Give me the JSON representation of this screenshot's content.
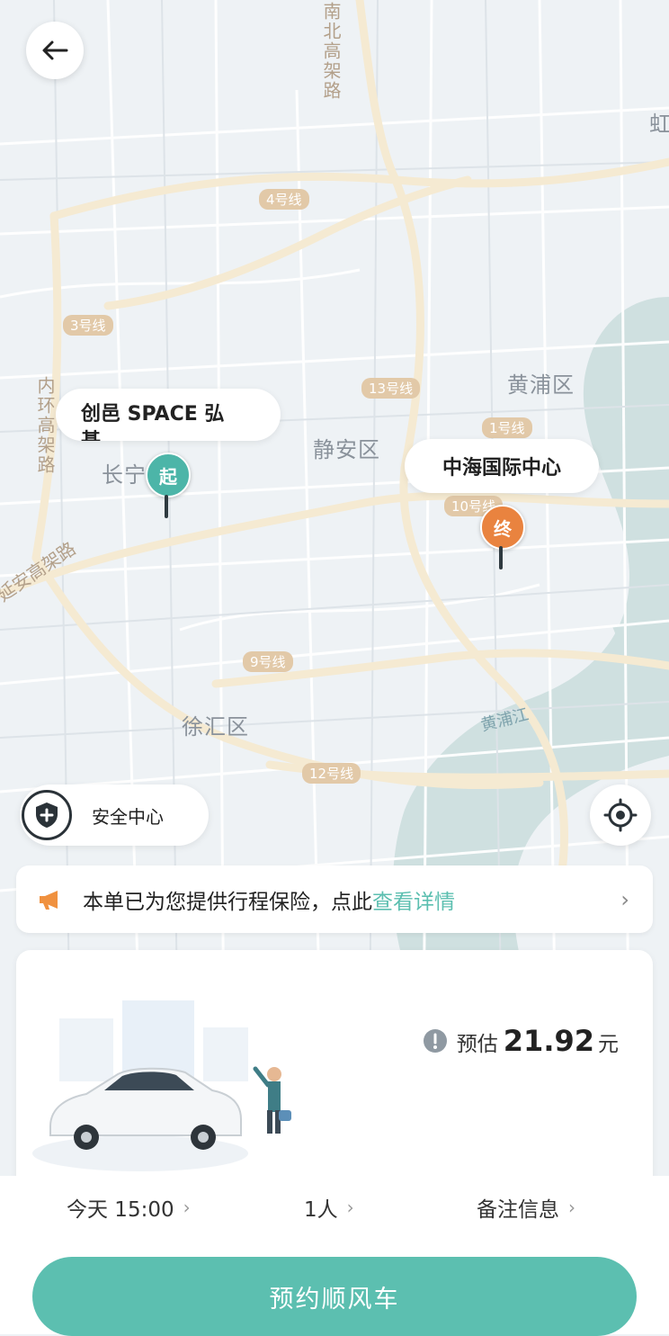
{
  "map": {
    "districts": [
      "黄浦区",
      "静安区",
      "长宁",
      "徐汇区",
      "虹"
    ],
    "metro_lines": [
      "4号线",
      "3号线",
      "13号线",
      "1号线",
      "10号线",
      "9号线",
      "12号线"
    ],
    "roads": [
      "南北高架路",
      "内环高架路",
      "延安高架路"
    ],
    "river": "黄浦江"
  },
  "origin": {
    "label": "创邑 SPACE 弘基",
    "pin": "起",
    "color": "#4cb5a8"
  },
  "destination": {
    "label": "中海国际中心",
    "pin": "终",
    "color": "#e9833f"
  },
  "safety_center": {
    "label": "安全中心",
    "icon": "shield-plus-icon"
  },
  "notice": {
    "text": "本单已为您提供行程保险，点此",
    "link": "查看详情",
    "icon": "megaphone-icon"
  },
  "estimate": {
    "label": "预估",
    "price": "21.92",
    "unit": "元"
  },
  "options": {
    "time": "今天 15:00",
    "passengers": "1人",
    "remarks": "备注信息"
  },
  "book_button": {
    "label": "预约顺风车"
  },
  "colors": {
    "accent": "#5cbfb0",
    "origin": "#4cb5a8",
    "destination": "#e9833f"
  }
}
